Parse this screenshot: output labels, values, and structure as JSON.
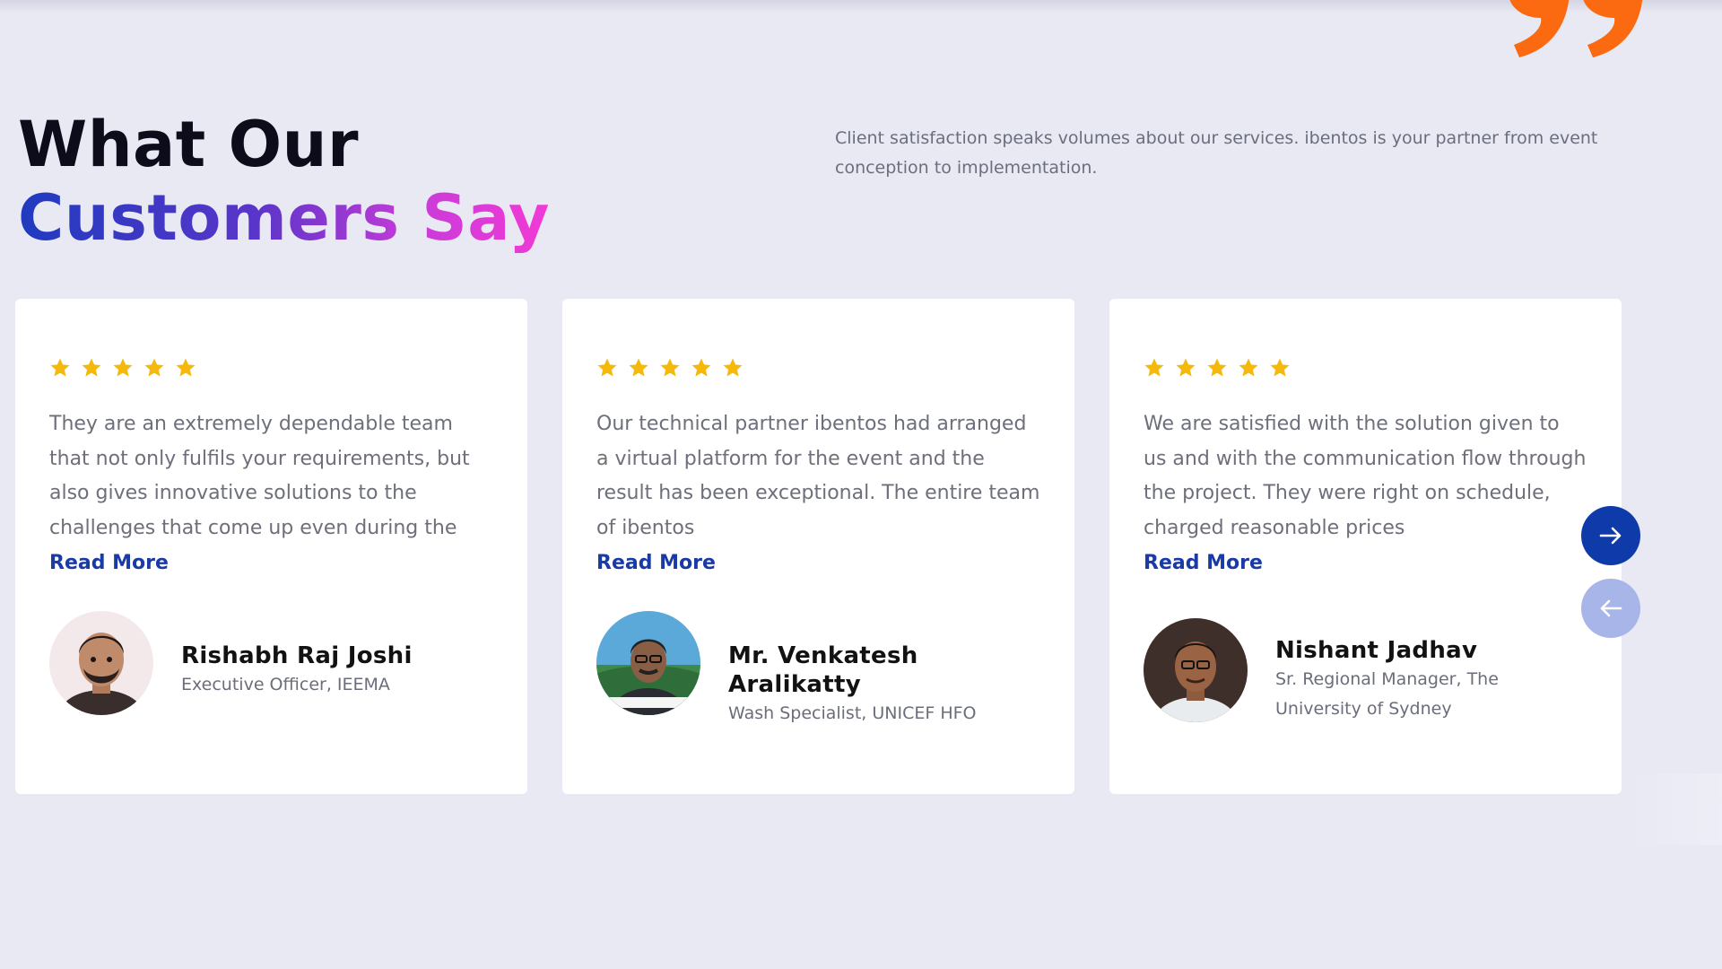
{
  "section": {
    "heading_line1": "What Our",
    "heading_line2": "Customers Say",
    "intro": "Client satisfaction speaks volumes about our services. ibentos is your partner from event conception to implementation."
  },
  "testimonials": [
    {
      "rating": 5,
      "text": "They are an extremely dependable team that not only fulfils your requirements, but also gives innovative solutions to the challenges that come up even during the event.",
      "read_more": "Read More",
      "name": "Rishabh Raj Joshi",
      "role": "Executive Officer, IEEMA"
    },
    {
      "rating": 5,
      "text": "Our technical partner ibentos had arranged a virtual platform for the event and the result has been exceptional. The entire team of ibentos",
      "read_more": "Read More",
      "name": "Mr. Venkatesh Aralikatty",
      "role": "Wash Specialist, UNICEF HFO"
    },
    {
      "rating": 5,
      "text": "We are satisfied with the solution given to us and with the communication flow through the project. They were right on schedule, charged reasonable prices",
      "read_more": "Read More",
      "name": "Nishant Jadhav",
      "role": "Sr. Regional Manager, The University of Sydney"
    }
  ],
  "navigation": {
    "next_icon": "arrow-right-icon",
    "prev_icon": "arrow-left-icon"
  },
  "colors": {
    "background": "#e8e9f3",
    "card": "#ffffff",
    "star": "#f5b90c",
    "link": "#1a3aa6",
    "quote": "#fb6a10",
    "nav_active": "#0f3aa9",
    "nav_inactive": "#a8b5e9",
    "gradient": [
      "#1f3bbf",
      "#f23ad6"
    ]
  }
}
